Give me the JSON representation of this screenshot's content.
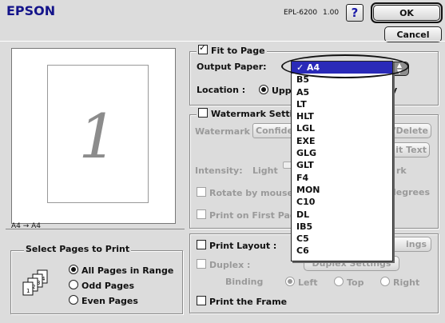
{
  "header": {
    "brand": "EPSON",
    "model": "EPL-6200",
    "version": "1.00",
    "help_label": "?",
    "ok_label": "OK",
    "cancel_label": "Cancel"
  },
  "preview": {
    "page_number": "1",
    "mapping": "A4 → A4"
  },
  "fit_to_page": {
    "label": "Fit to Page",
    "checked": true
  },
  "output_paper": {
    "label": "Output Paper:",
    "selected": "A4",
    "options": [
      "A4",
      "B5",
      "A5",
      "LT",
      "HLT",
      "LGL",
      "EXE",
      "GLG",
      "GLT",
      "F4",
      "MON",
      "C10",
      "DL",
      "IB5",
      "C5",
      "C6"
    ]
  },
  "location": {
    "label": "Location :",
    "option": "Uppe",
    "trailing": "y"
  },
  "watermark": {
    "checkbox_label": "Watermark Settin",
    "watermark_label": "Watermark :",
    "watermark_value": "Confide",
    "add_delete_label": "y/Delete",
    "edit_text_label": "it Text",
    "intensity_label": "Intensity:",
    "intensity_light": "Light",
    "intensity_dark": "rk",
    "rotate_label": "Rotate by mouse",
    "degrees_label": "legrees",
    "first_page_label": "Print on First Page"
  },
  "layout": {
    "print_layout_label": "Print Layout :",
    "settings_label": "ings",
    "duplex_label": "Duplex :",
    "duplex_settings_label": "Duplex Settings",
    "binding_label": "Binding",
    "binding_options": [
      "Left",
      "Top",
      "Right"
    ],
    "print_frame_label": "Print the Frame"
  },
  "pages_group": {
    "title": "Select Pages to Print",
    "options": [
      "All Pages in Range",
      "Odd Pages",
      "Even Pages"
    ]
  }
}
